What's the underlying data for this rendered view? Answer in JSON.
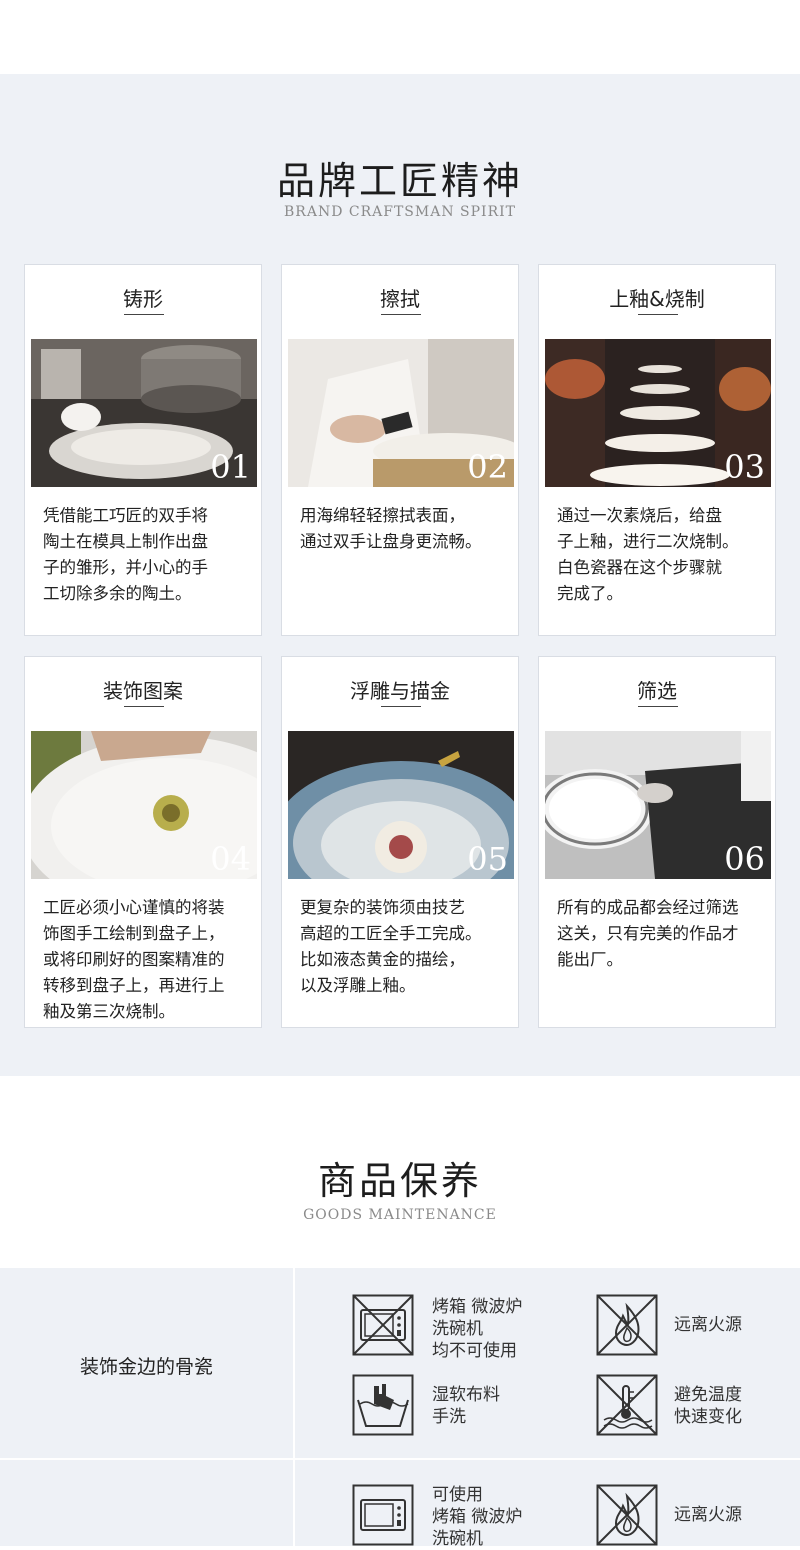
{
  "craftsman": {
    "title": "品牌工匠精神",
    "subtitle": "BRAND CRAFTSMAN SPIRIT",
    "steps": [
      {
        "title": "铸形",
        "number": "01",
        "desc": "凭借能工巧匠的双手将\n陶土在模具上制作出盘\n子的雏形，并小心的手\n工切除多余的陶土。"
      },
      {
        "title": "擦拭",
        "number": "02",
        "desc": "用海绵轻轻擦拭表面，\n通过双手让盘身更流畅。"
      },
      {
        "title": "上釉&烧制",
        "number": "03",
        "desc": "通过一次素烧后，给盘\n子上釉，进行二次烧制。\n白色瓷器在这个步骤就\n完成了。"
      },
      {
        "title": "装饰图案",
        "number": "04",
        "desc": "工匠必须小心谨慎的将装\n饰图手工绘制到盘子上，\n或将印刷好的图案精准的\n转移到盘子上，再进行上\n釉及第三次烧制。"
      },
      {
        "title": "浮雕与描金",
        "number": "05",
        "desc": "更复杂的装饰须由技艺\n高超的工匠全手工完成。\n比如液态黄金的描绘，\n以及浮雕上釉。"
      },
      {
        "title": "筛选",
        "number": "06",
        "desc": "所有的成品都会经过筛选\n这关，只有完美的作品才\n能出厂。"
      }
    ]
  },
  "maintenance": {
    "title": "商品保养",
    "subtitle": "GOODS MAINTENANCE",
    "rows": [
      {
        "label": "装饰金边的骨瓷",
        "items": [
          {
            "icon": "microwave-crossed-icon",
            "text": "烤箱 微波炉\n洗碗机\n均不可使用"
          },
          {
            "icon": "no-fire-icon",
            "text": "远离火源"
          },
          {
            "icon": "hand-wash-icon",
            "text": "湿软布料\n手洗"
          },
          {
            "icon": "temperature-change-icon",
            "text": "避免温度\n快速变化"
          }
        ]
      },
      {
        "label": "",
        "items": [
          {
            "icon": "microwave-icon",
            "text": "可使用\n烤箱 微波炉\n洗碗机"
          },
          {
            "icon": "no-fire-icon",
            "text": "远离火源"
          }
        ]
      }
    ]
  }
}
